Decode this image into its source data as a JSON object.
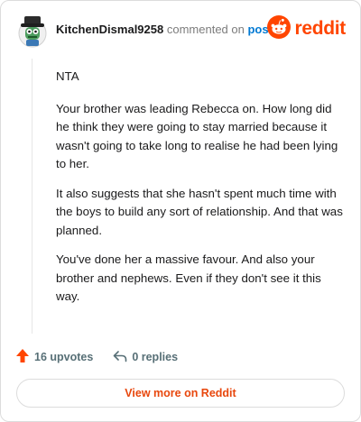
{
  "comment": {
    "author": "KitchenDismal9258",
    "action_text": "commented on",
    "post_link": "post",
    "paragraphs": [
      "NTA",
      "Your brother was leading Rebecca on. How long did he think they were going to stay married because it wasn't going to take long to realise he had been lying to her.",
      "It also suggests that she hasn't spent much time with the boys to build any sort of relationship. And that was planned.",
      "You've done her a massive favour. And also your brother and nephews. Even if they don't see it this way."
    ]
  },
  "brand": {
    "wordmark": "reddit",
    "color": "#ff4500"
  },
  "actions": {
    "upvotes_label": "16 upvotes",
    "replies_label": "0 replies"
  },
  "footer": {
    "view_more_label": "View more on Reddit"
  },
  "icons": {
    "avatar": "user-avatar-icon",
    "logo": "reddit-logo-icon",
    "upvote": "upvote-arrow-icon",
    "reply": "reply-arrow-icon"
  }
}
